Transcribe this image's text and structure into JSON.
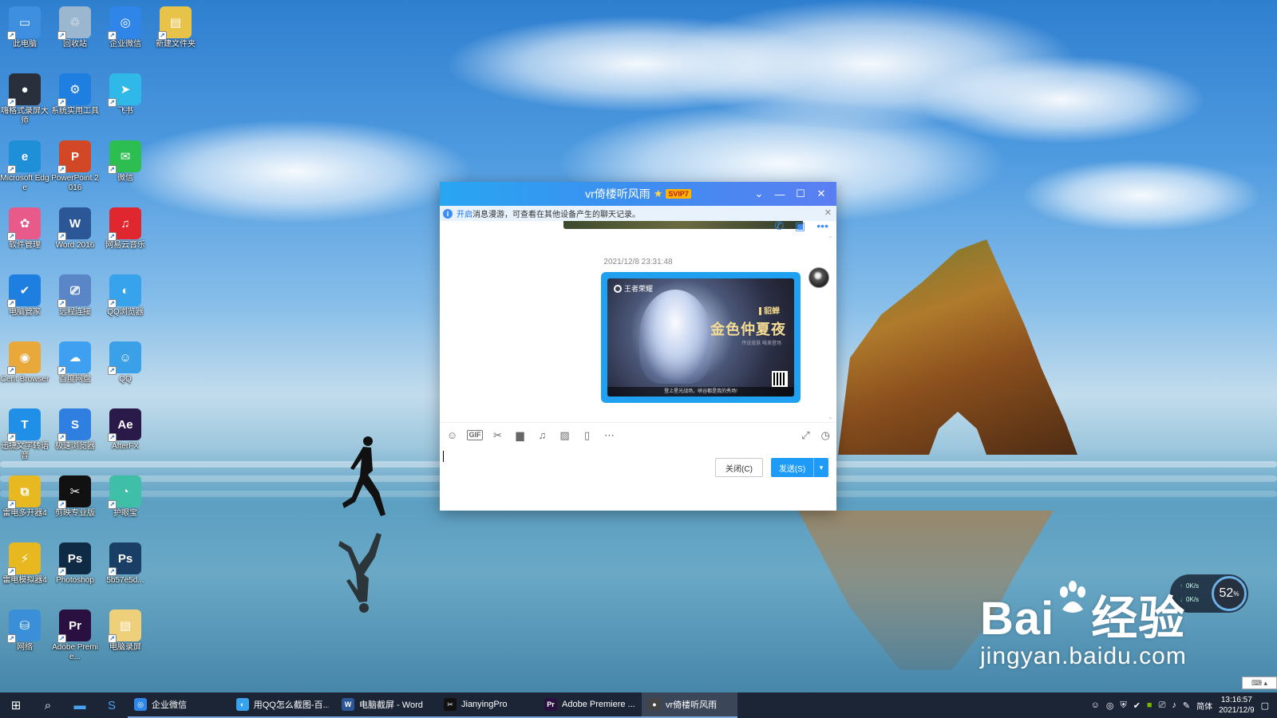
{
  "desktop": {
    "icons": [
      {
        "label": "此电脑",
        "color": "#3f8fe0",
        "glyph": "▭",
        "icon": "computer-icon"
      },
      {
        "label": "回收站",
        "color": "#9bb7cf",
        "glyph": "♲",
        "icon": "recycle-bin-icon"
      },
      {
        "label": "企业微信",
        "color": "#2f86e8",
        "glyph": "◎",
        "icon": "wecom-icon"
      },
      {
        "label": "新建文件夹",
        "color": "#e8c34a",
        "glyph": "▤",
        "icon": "folder-icon"
      },
      {
        "label": "嗨格式录屏大师",
        "color": "#2a2f3c",
        "glyph": "●",
        "icon": "screen-recorder-icon"
      },
      {
        "label": "系统实用工具",
        "color": "#1f7fe0",
        "glyph": "⚙",
        "icon": "gear-icon"
      },
      {
        "label": "飞书",
        "color": "#2fb8e8",
        "glyph": "➤",
        "icon": "feishu-icon"
      },
      {
        "label": "Microsoft Edge",
        "color": "#1f8fd8",
        "glyph": "e",
        "icon": "edge-icon"
      },
      {
        "label": "PowerPoint 2016",
        "color": "#d24726",
        "glyph": "P",
        "icon": "powerpoint-icon"
      },
      {
        "label": "微信",
        "color": "#2dbe52",
        "glyph": "✉",
        "icon": "wechat-icon"
      },
      {
        "label": "软件管理",
        "color": "#e85a8a",
        "glyph": "✿",
        "icon": "software-manager-icon"
      },
      {
        "label": "Word 2016",
        "color": "#2b5797",
        "glyph": "W",
        "icon": "word-icon"
      },
      {
        "label": "网易云音乐",
        "color": "#e0262f",
        "glyph": "♫",
        "icon": "netease-music-icon"
      },
      {
        "label": "电脑管家",
        "color": "#1f7fe0",
        "glyph": "✔",
        "icon": "pc-manager-icon"
      },
      {
        "label": "远程连接",
        "color": "#5a86c8",
        "glyph": "⎚",
        "icon": "remote-desktop-icon"
      },
      {
        "label": "QQ浏览器",
        "color": "#36a3ec",
        "glyph": "◐",
        "icon": "qq-browser-icon"
      },
      {
        "label": "Cent Browser",
        "color": "#e8a83a",
        "glyph": "◉",
        "icon": "cent-browser-icon"
      },
      {
        "label": "百度网盘",
        "color": "#3f9ff0",
        "glyph": "☁",
        "icon": "baidu-netdisk-icon"
      },
      {
        "label": "QQ",
        "color": "#3aa0e8",
        "glyph": "☺",
        "icon": "qq-icon"
      },
      {
        "label": "迅捷文字转语音",
        "color": "#1f8fe8",
        "glyph": "T",
        "icon": "tts-icon"
      },
      {
        "label": "极速浏览器",
        "color": "#2f7fe0",
        "glyph": "S",
        "icon": "speed-browser-icon"
      },
      {
        "label": "AfterFX",
        "color": "#2a1a4a",
        "glyph": "Ae",
        "icon": "after-effects-icon"
      },
      {
        "label": "雷电多开器4",
        "color": "#e8b820",
        "glyph": "⧉",
        "icon": "ld-multi-icon"
      },
      {
        "label": "剪映专业版",
        "color": "#111111",
        "glyph": "✂",
        "icon": "jianying-icon"
      },
      {
        "label": "护眼宝",
        "color": "#3fbfa8",
        "glyph": "◔",
        "icon": "eye-care-icon"
      },
      {
        "label": "雷电模拟器4",
        "color": "#e8b820",
        "glyph": "⚡",
        "icon": "ld-player-icon"
      },
      {
        "label": "Photoshop",
        "color": "#0f2a44",
        "glyph": "Ps",
        "icon": "photoshop-icon"
      },
      {
        "label": "5b57e5d...",
        "color": "#1a3f66",
        "glyph": "Ps",
        "icon": "psd-file-icon"
      },
      {
        "label": "网络",
        "color": "#3a8fd8",
        "glyph": "⛁",
        "icon": "network-icon"
      },
      {
        "label": "Adobe Premie...",
        "color": "#2a1040",
        "glyph": "Pr",
        "icon": "premiere-icon"
      },
      {
        "label": "电脑录屏",
        "color": "#efd07a",
        "glyph": "▤",
        "icon": "folder-icon"
      }
    ]
  },
  "chat": {
    "title": "vr倚楼听风雨",
    "vip_badge": "SVIP7",
    "notice_link": "开启",
    "notice_text": "消息漫游，可查看在其他设备产生的聊天记录。",
    "timestamp": "2021/12/8 23:31:48",
    "image": {
      "brand": "王者荣耀",
      "hero": "貂蝉",
      "skin": "金色仲夏夜",
      "subtitle": "传说皮肤 唯美登场",
      "caption": "登上星光战场，峡谷都是我的秀场!"
    },
    "close_button": "关闭(C)",
    "send_button": "发送(S)"
  },
  "widget": {
    "up_speed": "0K/s",
    "down_speed": "0K/s",
    "cpu_percent": "52",
    "percent_sign": "%"
  },
  "watermark": {
    "brand_left": "Bai",
    "brand_right": "经验",
    "url": "jingyan.baidu.com"
  },
  "taskbar": {
    "tasks": [
      {
        "label": "企业微信",
        "icon": "wecom-icon",
        "color": "#2f86e8",
        "glyph": "◎"
      },
      {
        "label": "用QQ怎么截图-百...",
        "icon": "qq-browser-icon",
        "color": "#36a3ec",
        "glyph": "◐"
      },
      {
        "label": "电脑截屏 - Word",
        "icon": "word-icon",
        "color": "#2b5797",
        "glyph": "W"
      },
      {
        "label": "JianyingPro",
        "icon": "jianying-icon",
        "color": "#111111",
        "glyph": "✂"
      },
      {
        "label": "Adobe Premiere ...",
        "icon": "premiere-icon",
        "color": "#2a1040",
        "glyph": "Pr"
      },
      {
        "label": "vr倚楼听风雨",
        "icon": "qq-chat-avatar-icon",
        "color": "#444444",
        "glyph": "●"
      }
    ],
    "ime": "简体",
    "time": "13:16:57",
    "date": "2021/12/9"
  }
}
